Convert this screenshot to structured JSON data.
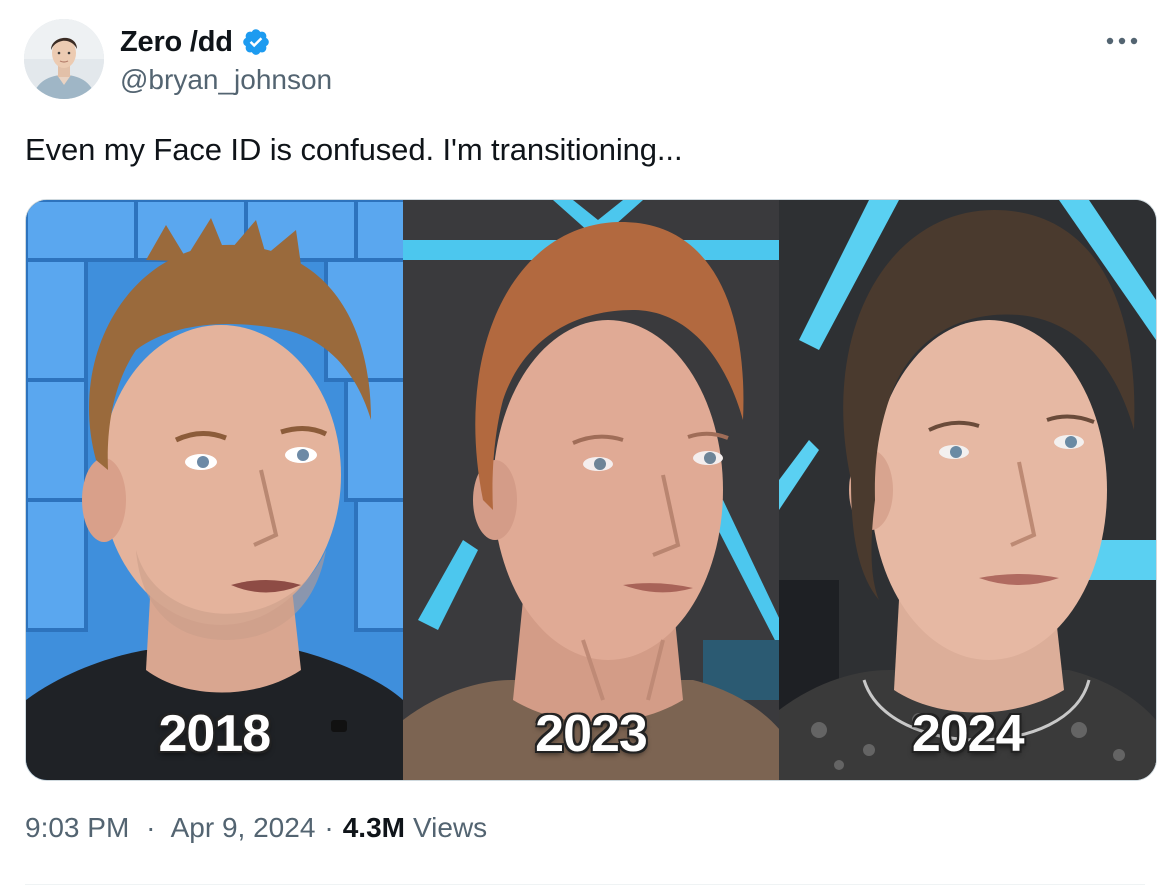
{
  "author": {
    "display_name": "Zero /dd",
    "handle": "@bryan_johnson",
    "verified": true,
    "verified_color": "#1d9bf0"
  },
  "more_icon": "more-horizontal-icon",
  "tweet": {
    "text": "Even my Face ID is confused. I'm transitioning..."
  },
  "media": {
    "panels": [
      {
        "label": "2018"
      },
      {
        "label": "2023"
      },
      {
        "label": "2024"
      }
    ]
  },
  "meta": {
    "time": "9:03 PM",
    "date": "Apr 9, 2024",
    "separator": "·",
    "views_count": "4.3M",
    "views_label": "Views"
  },
  "colors": {
    "text_primary": "#0f1419",
    "text_secondary": "#536471",
    "border": "#cfd9de"
  }
}
